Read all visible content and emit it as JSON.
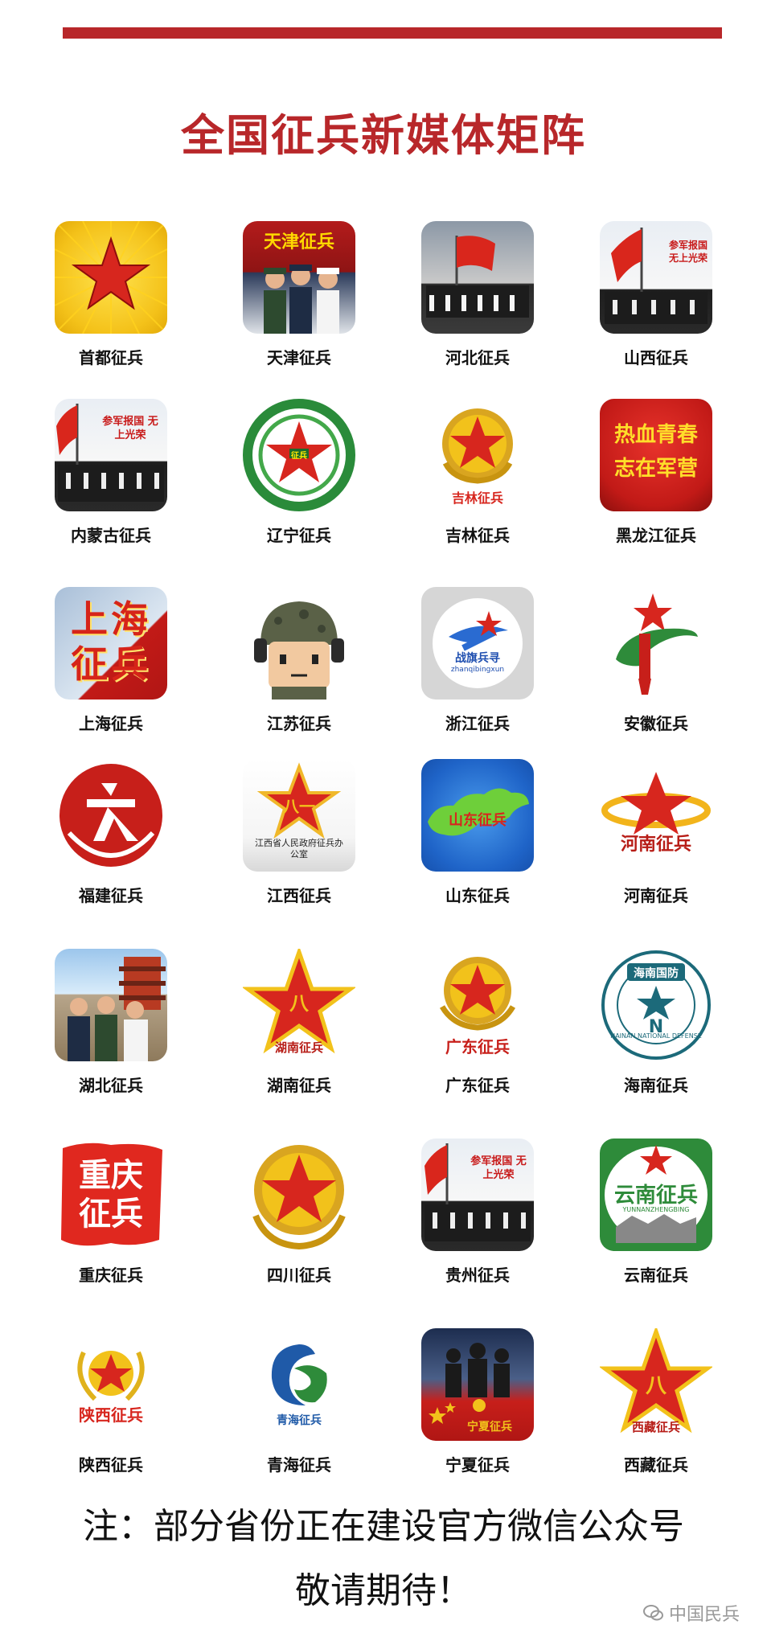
{
  "title": "全国征兵新媒体矩阵",
  "items": [
    {
      "label": "首都征兵",
      "icon": "sun-star-icon"
    },
    {
      "label": "天津征兵",
      "icon": "salute-soldiers-icon"
    },
    {
      "label": "河北征兵",
      "icon": "parade-flag-icon"
    },
    {
      "label": "山西征兵",
      "icon": "parade-flag-icon"
    },
    {
      "label": "内蒙古征兵",
      "icon": "parade-flag-icon"
    },
    {
      "label": "辽宁征兵",
      "icon": "green-ring-star-icon"
    },
    {
      "label": "吉林征兵",
      "icon": "army-emblem-icon"
    },
    {
      "label": "黑龙江征兵",
      "icon": "red-calligraphy-icon"
    },
    {
      "label": "上海征兵",
      "icon": "shanghai-characters-icon"
    },
    {
      "label": "江苏征兵",
      "icon": "cartoon-soldier-icon"
    },
    {
      "label": "浙江征兵",
      "icon": "blue-star-logo-icon"
    },
    {
      "label": "安徽征兵",
      "icon": "green-swirl-star-icon"
    },
    {
      "label": "福建征兵",
      "icon": "red-circle-logo-icon"
    },
    {
      "label": "江西征兵",
      "icon": "red-star-emblem-icon"
    },
    {
      "label": "山东征兵",
      "icon": "map-logo-icon"
    },
    {
      "label": "河南征兵",
      "icon": "star-ring-icon"
    },
    {
      "label": "湖北征兵",
      "icon": "great-wall-soldiers-icon"
    },
    {
      "label": "湖南征兵",
      "icon": "red-star-icon"
    },
    {
      "label": "广东征兵",
      "icon": "army-emblem-icon"
    },
    {
      "label": "海南征兵",
      "icon": "hainan-seal-icon"
    },
    {
      "label": "重庆征兵",
      "icon": "chongqing-characters-icon"
    },
    {
      "label": "四川征兵",
      "icon": "army-emblem-icon"
    },
    {
      "label": "贵州征兵",
      "icon": "parade-flag-icon"
    },
    {
      "label": "云南征兵",
      "icon": "yunnan-logo-icon"
    },
    {
      "label": "陕西征兵",
      "icon": "wreath-star-icon"
    },
    {
      "label": "青海征兵",
      "icon": "blue-swirl-icon"
    },
    {
      "label": "宁夏征兵",
      "icon": "flag-soldiers-icon"
    },
    {
      "label": "西藏征兵",
      "icon": "red-star-icon"
    }
  ],
  "icon_text": {
    "tianjin": "天津征兵",
    "jilin": "吉林征兵",
    "heilongjiang": "热血青春 志在军营",
    "shanghai": "上海征兵",
    "zhejiang": "战旗兵寻",
    "zhejiang_sub": "zhanqibingxun",
    "jiangxi": "江西省人民政府征兵办公室",
    "shandong": "山东征兵",
    "henan": "河南征兵",
    "hunan": "湖南征兵",
    "guangdong": "广东征兵",
    "hainan_top": "海南国防",
    "hainan_mid": "H N",
    "hainan_ring": "HAINAN NATIONAL DEFENSE",
    "chongqing": "重庆征兵",
    "yunnan": "云南征兵",
    "yunnan_sub": "YUNNANZHENGBING",
    "shaanxi": "陕西征兵",
    "qinghai": "青海征兵",
    "ningxia": "宁夏征兵",
    "xizang": "西藏征兵",
    "parade_slogan": "参军报国 无上光荣",
    "liaoning": "征兵"
  },
  "note_line1": "注：部分省份正在建设官方微信公众号",
  "note_line2": "敬请期待！",
  "watermark": "中国民兵",
  "colors": {
    "accent": "#b8272a",
    "gold": "#f2c21b",
    "green": "#2e8b3a",
    "blue": "#2a6bd1"
  }
}
